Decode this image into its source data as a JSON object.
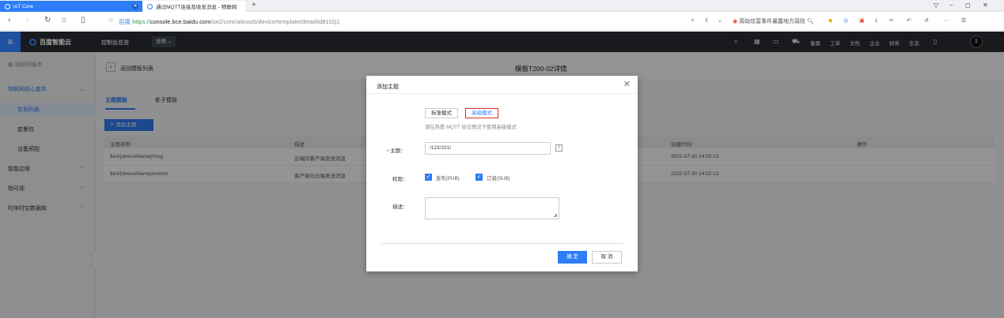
{
  "browser": {
    "active_tab": "IoT Core",
    "other_tab": "通过MQTT连接及收发消息 - 物联网",
    "new_tab": "+",
    "window_controls": [
      "▽",
      "−",
      "◻",
      "✕"
    ],
    "url_secure_label": "百度",
    "url_protocol": "https://",
    "url_domain": "console.bce.baidu.com",
    "url_path": "/iot2/core/aitcwzb/device/template/detail/td8102j1",
    "search_suggestion": "周劫炫富事件暴露地方腐败"
  },
  "header": {
    "brand": "百度智能云",
    "console_link": "控制台总览",
    "region": "全局",
    "links": [
      "备案",
      "工单",
      "文档",
      "企业",
      "财务",
      "生态"
    ],
    "avatar": "1"
  },
  "sidebar": {
    "product": "物联网服务",
    "group": "物联网核心套件",
    "items": [
      "实例列表",
      "套餐包",
      "设备预配"
    ],
    "sections": [
      "智能边缘",
      "物可视",
      "时序时空数据库"
    ]
  },
  "page": {
    "back_label": "返回模板列表",
    "title": "模板T200-02详情",
    "tabs": [
      "主题模板",
      "影子模板"
    ],
    "add_button": "添加主题",
    "columns": [
      "主题名称",
      "描述",
      "创建时间",
      "操作"
    ],
    "rows": [
      {
        "name": "$iot/{deviceName}/msg",
        "desc": "云端向客户端发送消息",
        "time": "2022-07-30 14:02:13"
      },
      {
        "name": "$iot/{deviceName}/events",
        "desc": "客户端向云端发送消息",
        "time": "2022-07-30 14:02:13"
      }
    ]
  },
  "dialog": {
    "title": "添加主题",
    "mode_standard": "标准模式",
    "mode_advanced": "高级模式",
    "hint": "请在熟悉 MQTT 协议情况下使用高级模式",
    "topic_label": "主题：",
    "topic_value": "/123/321/",
    "help": "?",
    "perm_label": "权限：",
    "perm_pub": "发布(PUB)",
    "perm_sub": "订阅(SUB)",
    "desc_label": "描述：",
    "ok": "确 定",
    "cancel": "取 消"
  }
}
